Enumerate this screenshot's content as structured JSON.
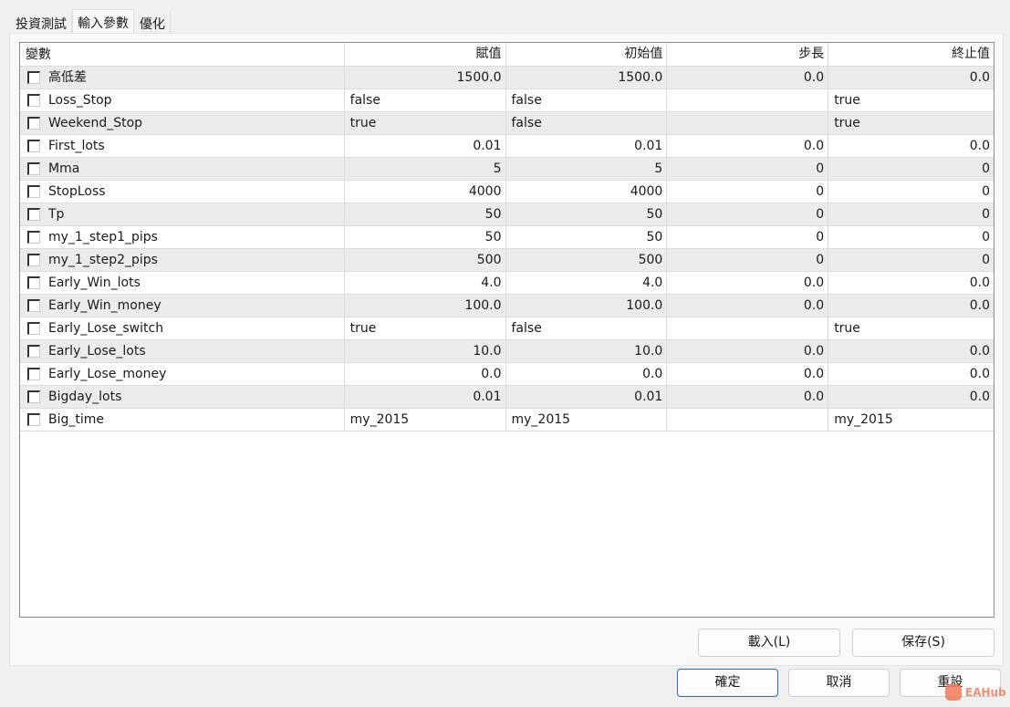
{
  "tabs": [
    "投資測試",
    "輸入參數",
    "優化"
  ],
  "active_tab": 1,
  "columns": [
    "變數",
    "賦值",
    "初始值",
    "步長",
    "終止值"
  ],
  "rows": [
    [
      "高低差",
      "1500.0",
      "1500.0",
      "0.0",
      "0.0"
    ],
    [
      "Loss_Stop",
      "false",
      "false",
      "",
      "true"
    ],
    [
      "Weekend_Stop",
      "true",
      "false",
      "",
      "true"
    ],
    [
      "First_lots",
      "0.01",
      "0.01",
      "0.0",
      "0.0"
    ],
    [
      "Mma",
      "5",
      "5",
      "0",
      "0"
    ],
    [
      "StopLoss",
      "4000",
      "4000",
      "0",
      "0"
    ],
    [
      "Tp",
      "50",
      "50",
      "0",
      "0"
    ],
    [
      "my_1_step1_pips",
      "50",
      "50",
      "0",
      "0"
    ],
    [
      "my_1_step2_pips",
      "500",
      "500",
      "0",
      "0"
    ],
    [
      "Early_Win_lots",
      "4.0",
      "4.0",
      "0.0",
      "0.0"
    ],
    [
      "Early_Win_money",
      "100.0",
      "100.0",
      "0.0",
      "0.0"
    ],
    [
      "Early_Lose_switch",
      "true",
      "false",
      "",
      "true"
    ],
    [
      "Early_Lose_lots",
      "10.0",
      "10.0",
      "0.0",
      "0.0"
    ],
    [
      "Early_Lose_money",
      "0.0",
      "0.0",
      "0.0",
      "0.0"
    ],
    [
      "Bigday_lots",
      "0.01",
      "0.01",
      "0.0",
      "0.0"
    ],
    [
      "Big_time",
      "my_2015",
      "my_2015",
      "",
      "my_2015"
    ]
  ],
  "buttons": {
    "load": "載入(L)",
    "save": "保存(S)",
    "ok": "確定",
    "cancel": "取消",
    "reset": "重設"
  },
  "watermark": "EAHub"
}
